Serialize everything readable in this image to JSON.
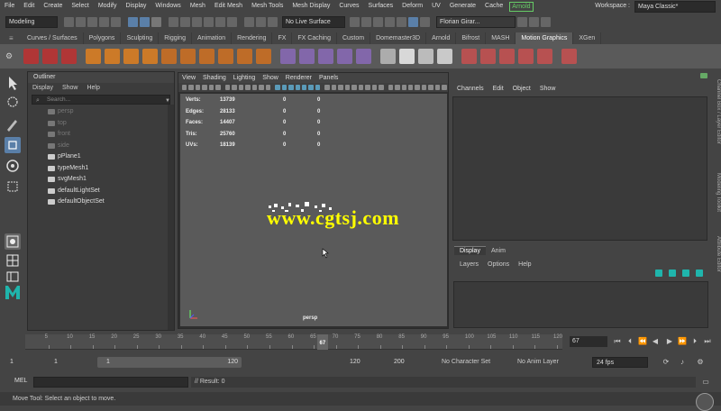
{
  "menubar": {
    "items": [
      "File",
      "Edit",
      "Create",
      "Select",
      "Modify",
      "Display",
      "Windows",
      "Mesh",
      "Edit Mesh",
      "Mesh Tools",
      "Mesh Display",
      "Curves",
      "Surfaces",
      "Deform",
      "UV",
      "Generate",
      "Cache"
    ],
    "arnold": "Arnold",
    "workspace_label": "Workspace :",
    "workspace_value": "Maya Classic*"
  },
  "statusline": {
    "mode": "Modeling",
    "live_surface": "No Live Surface",
    "user": "Florian Girar..."
  },
  "shelf_tabs": [
    "Curves / Surfaces",
    "Polygons",
    "Sculpting",
    "Rigging",
    "Animation",
    "Rendering",
    "FX",
    "FX Caching",
    "Custom",
    "Domemaster3D",
    "Arnold",
    "Bifrost",
    "MASH",
    "Motion Graphics",
    "XGen"
  ],
  "shelf_active": "Motion Graphics",
  "outliner": {
    "title": "Outliner",
    "menu": [
      "Display",
      "Show",
      "Help"
    ],
    "search_placeholder": "Search...",
    "items": [
      {
        "label": "persp",
        "dim": true
      },
      {
        "label": "top",
        "dim": true
      },
      {
        "label": "front",
        "dim": true
      },
      {
        "label": "side",
        "dim": true
      },
      {
        "label": "pPlane1",
        "dim": false
      },
      {
        "label": "typeMesh1",
        "dim": false
      },
      {
        "label": "svgMesh1",
        "dim": false
      },
      {
        "label": "defaultLightSet",
        "dim": false
      },
      {
        "label": "defaultObjectSet",
        "dim": false
      }
    ]
  },
  "viewport": {
    "menu": [
      "View",
      "Shading",
      "Lighting",
      "Show",
      "Renderer",
      "Panels"
    ],
    "hud": [
      {
        "label": "Verts:",
        "v1": "13739",
        "v2": "0",
        "v3": "0"
      },
      {
        "label": "Edges:",
        "v1": "28133",
        "v2": "0",
        "v3": "0"
      },
      {
        "label": "Faces:",
        "v1": "14407",
        "v2": "0",
        "v3": "0"
      },
      {
        "label": "Tris:",
        "v1": "25760",
        "v2": "0",
        "v3": "0"
      },
      {
        "label": "UVs:",
        "v1": "18139",
        "v2": "0",
        "v3": "0"
      }
    ],
    "camera": "persp",
    "watermark": "www.cgtsj.com"
  },
  "channelbox": {
    "menu": [
      "Channels",
      "Edit",
      "Object",
      "Show"
    ]
  },
  "layereditor": {
    "tabs": [
      "Display",
      "Anim"
    ],
    "menu": [
      "Layers",
      "Options",
      "Help"
    ]
  },
  "side_tabs": [
    "Channel Box / Layer Editor",
    "Modeling Toolkit",
    "Attribute Editor"
  ],
  "timeslider": {
    "ticks": [
      "5",
      "10",
      "15",
      "20",
      "25",
      "30",
      "35",
      "40",
      "45",
      "50",
      "55",
      "60",
      "65",
      "70",
      "75",
      "80",
      "85",
      "90",
      "95",
      "100",
      "105",
      "110",
      "115",
      "120"
    ],
    "current": "67",
    "frame_field": "67"
  },
  "rangeslider": {
    "start": "1",
    "anim_start": "1",
    "range_start": "1",
    "range_end": "120",
    "anim_end": "120",
    "end": "200",
    "character_set": "No Character Set",
    "anim_layer": "No Anim Layer",
    "fps": "24 fps"
  },
  "cmdline": {
    "lang": "MEL",
    "result": "// Result: 0"
  },
  "helpline": "Move Tool: Select an object to move."
}
